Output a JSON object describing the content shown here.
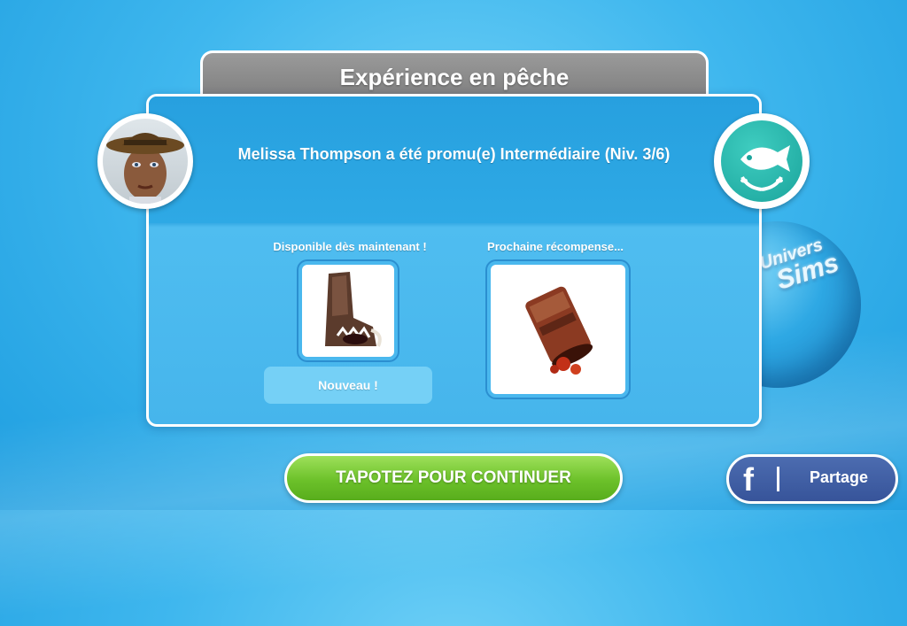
{
  "dialog": {
    "title": "Expérience en pêche",
    "message": "Melissa Thompson a été promu(e) Intermédiaire (Niv. 3/6)",
    "available_label": "Disponible dès maintenant !",
    "next_label": "Prochaine récompense...",
    "new_badge": "Nouveau !"
  },
  "buttons": {
    "continue": "TAPOTEZ POUR CONTINUER",
    "share": "Partage",
    "share_icon": "f"
  },
  "ornament": {
    "logo_line1": "L'Univers",
    "logo_line2": "Sims"
  },
  "icons": {
    "avatar": "sim-portrait",
    "skill": "fish-icon",
    "available_item": "boot-item",
    "next_item": "can-item"
  }
}
